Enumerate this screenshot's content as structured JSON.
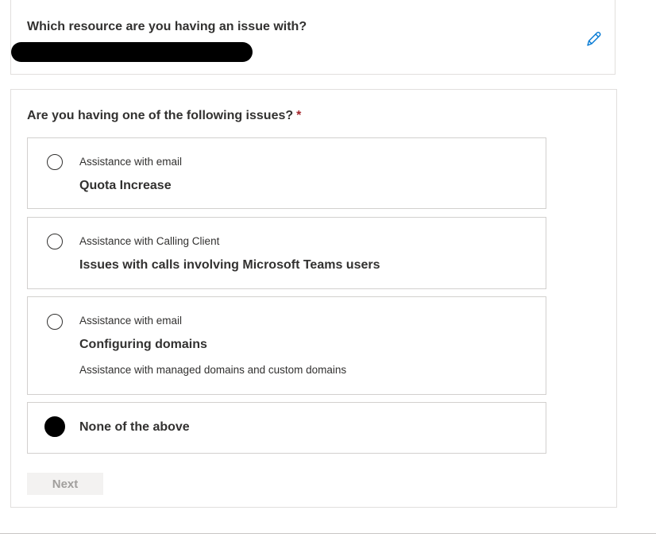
{
  "resource": {
    "question": "Which resource are you having an issue with?",
    "edit_icon": "pencil-icon"
  },
  "issues": {
    "question": "Are you having one of the following issues?",
    "required_marker": "*",
    "options": [
      {
        "category": "Assistance with email",
        "title": "Quota Increase",
        "description": "",
        "selected": false
      },
      {
        "category": "Assistance with Calling Client",
        "title": "Issues with calls involving Microsoft Teams users",
        "description": "",
        "selected": false
      },
      {
        "category": "Assistance with email",
        "title": "Configuring domains",
        "description": "Assistance with managed domains and custom domains",
        "selected": false
      },
      {
        "category": "",
        "title": "None of the above",
        "description": "",
        "selected": true
      }
    ],
    "next_label": "Next"
  },
  "colors": {
    "required": "#a4262c",
    "edit_icon": "#0078d4",
    "disabled_button_bg": "#f3f2f1",
    "disabled_button_text": "#a19f9d"
  }
}
